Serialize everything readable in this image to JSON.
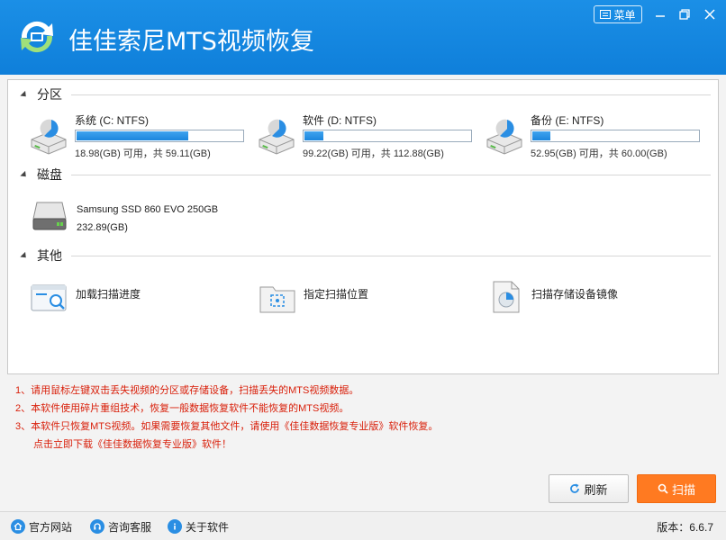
{
  "app": {
    "title": "佳佳索尼MTS视频恢复",
    "menu_label": "菜单"
  },
  "sections": {
    "partitions_title": "分区",
    "disks_title": "磁盘",
    "other_title": "其他"
  },
  "partitions": [
    {
      "name": "系统 (C: NTFS)",
      "info": "18.98(GB) 可用，共 59.11(GB)",
      "used_fraction": 0.679
    },
    {
      "name": "软件 (D: NTFS)",
      "info": "99.22(GB) 可用，共 112.88(GB)",
      "used_fraction": 0.121
    },
    {
      "name": "备份 (E: NTFS)",
      "info": "52.95(GB) 可用，共 60.00(GB)",
      "used_fraction": 0.118
    }
  ],
  "disk": {
    "name": "Samsung SSD 860 EVO 250GB",
    "size": "232.89(GB)"
  },
  "other": {
    "load_progress": "加载扫描进度",
    "specify_location": "指定扫描位置",
    "scan_image": "扫描存储设备镜像"
  },
  "notes": {
    "line1": "1、请用鼠标左键双击丢失视频的分区或存储设备，扫描丢失的MTS视频数据。",
    "line2": "2、本软件使用碎片重组技术，恢复一般数据恢复软件不能恢复的MTS视频。",
    "line3": "3、本软件只恢复MTS视频。如果需要恢复其他文件，请使用《佳佳数据恢复专业版》软件恢复。",
    "line4": "点击立即下载《佳佳数据恢复专业版》软件！"
  },
  "buttons": {
    "refresh": "刷新",
    "scan": "扫描"
  },
  "statusbar": {
    "website": "官方网站",
    "support": "咨询客服",
    "about": "关于软件",
    "version": "版本：6.6.7"
  },
  "colors": {
    "title_bar": "#1584e0",
    "progress": "#1b86dd",
    "scan_button": "#ff7a21",
    "notes_text": "#d9200b"
  }
}
